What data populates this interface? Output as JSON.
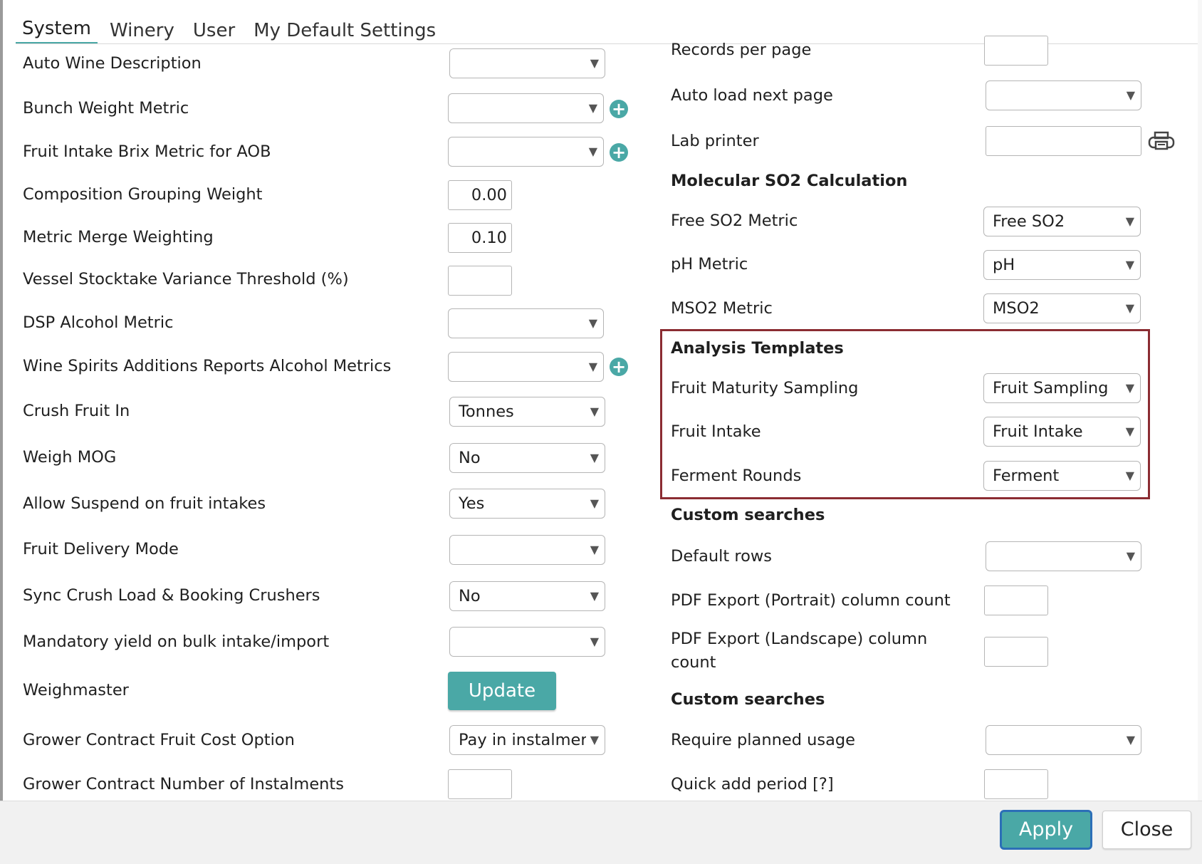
{
  "tabs": [
    "System",
    "Winery",
    "User",
    "My Default Settings"
  ],
  "left": {
    "auto_wine_description": {
      "label": "Auto Wine Description",
      "value": ""
    },
    "bunch_weight_metric": {
      "label": "Bunch Weight Metric",
      "value": ""
    },
    "fruit_intake_brix_metric": {
      "label": "Fruit Intake Brix Metric for AOB",
      "value": ""
    },
    "composition_grouping_weight": {
      "label": "Composition Grouping Weight",
      "value": "0.00"
    },
    "metric_merge_weighting": {
      "label": "Metric Merge Weighting",
      "value": "0.10"
    },
    "vessel_stocktake_variance": {
      "label": "Vessel Stocktake Variance Threshold (%)",
      "value": ""
    },
    "dsp_alcohol_metric": {
      "label": "DSP Alcohol Metric",
      "value": ""
    },
    "wine_spirits_additions": {
      "label": "Wine Spirits Additions Reports Alcohol Metrics",
      "value": ""
    },
    "crush_fruit_in": {
      "label": "Crush Fruit In",
      "value": "Tonnes"
    },
    "weigh_mog": {
      "label": "Weigh MOG",
      "value": "No"
    },
    "allow_suspend": {
      "label": "Allow Suspend on fruit intakes",
      "value": "Yes"
    },
    "fruit_delivery_mode": {
      "label": "Fruit Delivery Mode",
      "value": ""
    },
    "sync_crush_load": {
      "label": "Sync Crush Load & Booking Crushers",
      "value": "No"
    },
    "mandatory_yield": {
      "label": "Mandatory yield on bulk intake/import",
      "value": ""
    },
    "weighmaster": {
      "label": "Weighmaster",
      "button": "Update"
    },
    "grower_contract_cost_option": {
      "label": "Grower Contract Fruit Cost Option",
      "value": "Pay in instalmen"
    },
    "grower_contract_instalments": {
      "label": "Grower Contract Number of Instalments",
      "value": ""
    }
  },
  "right": {
    "records_per_page": {
      "label": "Records per page",
      "value": ""
    },
    "auto_load_next_page": {
      "label": "Auto load next page",
      "value": ""
    },
    "lab_printer": {
      "label": "Lab printer",
      "value": ""
    },
    "molecular_so2_heading": "Molecular SO2 Calculation",
    "free_so2_metric": {
      "label": "Free SO2 Metric",
      "value": "Free SO2"
    },
    "ph_metric": {
      "label": "pH Metric",
      "value": "pH"
    },
    "mso2_metric": {
      "label": "MSO2 Metric",
      "value": "MSO2"
    },
    "analysis_templates_heading": "Analysis Templates",
    "fruit_maturity_sampling": {
      "label": "Fruit Maturity Sampling",
      "value": "Fruit Sampling"
    },
    "fruit_intake": {
      "label": "Fruit Intake",
      "value": "Fruit Intake"
    },
    "ferment_rounds": {
      "label": "Ferment Rounds",
      "value": "Ferment"
    },
    "custom_searches_heading_1": "Custom searches",
    "default_rows": {
      "label": "Default rows",
      "value": ""
    },
    "pdf_export_portrait": {
      "label": "PDF Export (Portrait) column count",
      "value": ""
    },
    "pdf_export_landscape": {
      "label": "PDF Export (Landscape) column",
      "label_line2": "count",
      "value": ""
    },
    "custom_searches_heading_2": "Custom searches",
    "require_planned_usage": {
      "label": "Require planned usage",
      "value": ""
    },
    "quick_add_period": {
      "label": "Quick add period [?]",
      "value": ""
    }
  },
  "footer": {
    "apply": "Apply",
    "close": "Close"
  },
  "icons": {
    "dropdown_arrow": "▼",
    "plus": "+",
    "printer": "printer-icon"
  },
  "colors": {
    "accent": "#4aa8a6",
    "highlight_border": "#8b2c32",
    "apply_border": "#2c6fb7"
  }
}
